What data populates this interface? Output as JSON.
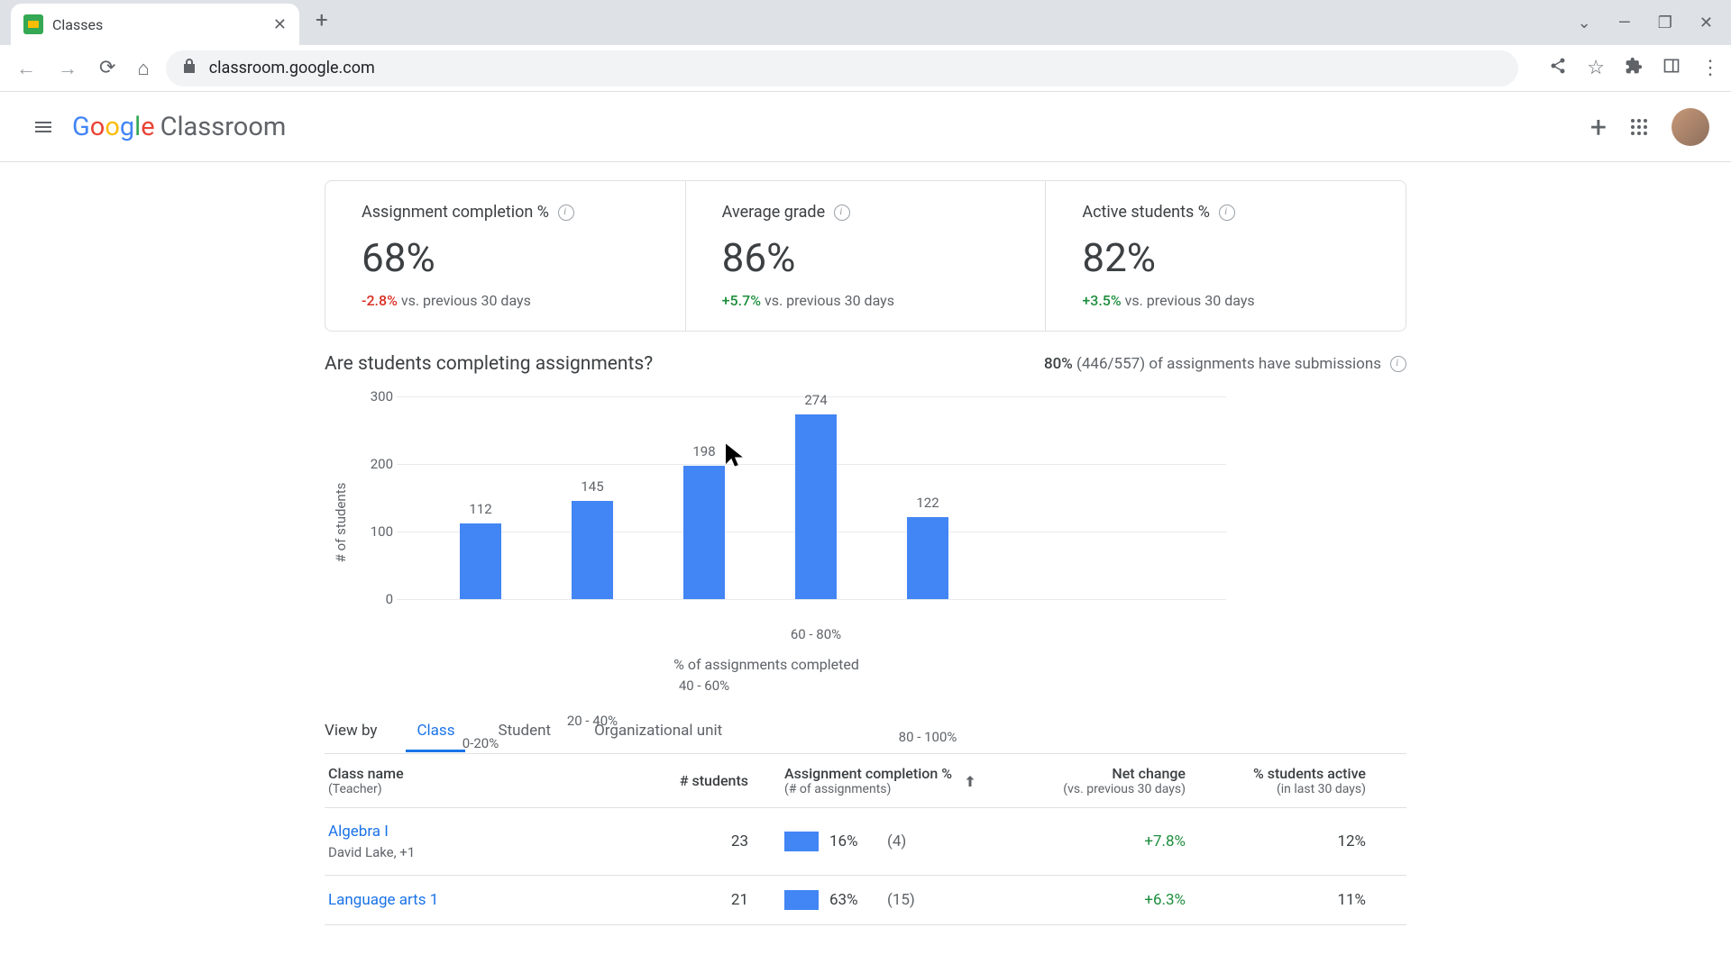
{
  "browser": {
    "tab_title": "Classes",
    "url": "classroom.google.com"
  },
  "app": {
    "logo_text": "Classroom"
  },
  "stats": {
    "completion": {
      "title": "Assignment completion %",
      "value": "68%",
      "delta": "-2.8%",
      "delta_text": " vs. previous 30 days"
    },
    "grade": {
      "title": "Average grade",
      "value": "86%",
      "delta": "+5.7%",
      "delta_text": " vs. previous 30 days"
    },
    "active": {
      "title": "Active students  %",
      "value": "82%",
      "delta": "+3.5%",
      "delta_text": " vs. previous 30 days"
    }
  },
  "chart_header": {
    "question": "Are students completing assignments?",
    "summary_bold": "80%",
    "summary_rest": " (446/557) of assignments have submissions"
  },
  "chart_data": {
    "type": "bar",
    "categories": [
      "0-20%",
      "20 - 40%",
      "40 - 60%",
      "60 - 80%",
      "80 - 100%"
    ],
    "values": [
      112,
      145,
      198,
      274,
      122
    ],
    "title": "Are students completing assignments?",
    "xlabel": "% of assignments completed",
    "ylabel": "# of students",
    "ylim": [
      0,
      300
    ],
    "yticks": [
      0,
      100,
      200,
      300
    ]
  },
  "view_by": {
    "label": "View by",
    "tabs": {
      "class": "Class",
      "student": "Student",
      "org": "Organizational unit"
    }
  },
  "table": {
    "headers": {
      "name": "Class name",
      "name_sub": "(Teacher)",
      "students": "# students",
      "completion": "Assignment completion %",
      "completion_sub": "(# of assignments)",
      "netchange": "Net change",
      "netchange_sub": "(vs. previous 30 days)",
      "active": "% students active",
      "active_sub": "(in last 30 days)"
    },
    "rows": [
      {
        "name": "Algebra I",
        "teacher": "David Lake, +1",
        "students": "23",
        "completion_pct": "16%",
        "completion_n": "(4)",
        "netchange": "+7.8%",
        "active": "12%"
      },
      {
        "name": "Language arts 1",
        "teacher": "",
        "students": "21",
        "completion_pct": "63%",
        "completion_n": "(15)",
        "netchange": "+6.3%",
        "active": "11%"
      }
    ]
  }
}
